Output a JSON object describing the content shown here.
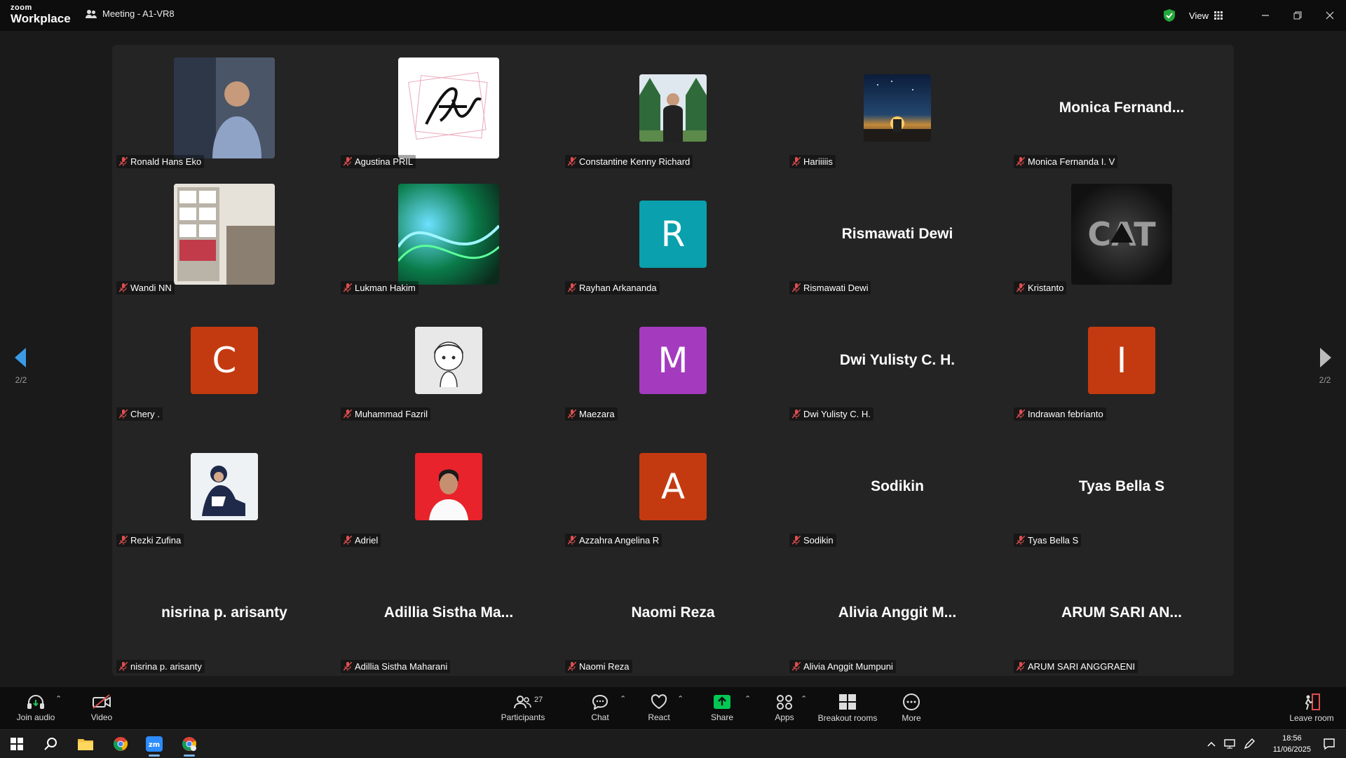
{
  "app": {
    "logo_small": "zoom",
    "logo_big": "Workplace",
    "meeting_title": "Meeting - A1-VR8"
  },
  "header": {
    "view_label": "View"
  },
  "pager": {
    "left": "2/2",
    "right": "2/2"
  },
  "tiles": [
    {
      "display": "",
      "tag": "Ronald Hans Eko"
    },
    {
      "display": "",
      "tag": "Agustina PRIL"
    },
    {
      "display": "",
      "tag": "Constantine Kenny Richard"
    },
    {
      "display": "",
      "tag": "Hariiiiis"
    },
    {
      "display": "Monica  Fernand...",
      "tag": "Monica Fernanda I. V"
    },
    {
      "display": "",
      "tag": "Wandi NN"
    },
    {
      "display": "",
      "tag": "Lukman Hakim"
    },
    {
      "display": "R",
      "tag": "Rayhan Arkananda"
    },
    {
      "display": "Rismawati Dewi",
      "tag": "Rismawati Dewi"
    },
    {
      "display": "",
      "tag": "Kristanto"
    },
    {
      "display": "C",
      "tag": "Chery ."
    },
    {
      "display": "",
      "tag": "Muhammad Fazril"
    },
    {
      "display": "M",
      "tag": "Maezara"
    },
    {
      "display": "Dwi Yulisty C. H.",
      "tag": "Dwi Yulisty C. H."
    },
    {
      "display": "I",
      "tag": "Indrawan febrianto"
    },
    {
      "display": "",
      "tag": "Rezki Zufina"
    },
    {
      "display": "",
      "tag": "Adriel"
    },
    {
      "display": "A",
      "tag": "Azzahra Angelina R"
    },
    {
      "display": "Sodikin",
      "tag": "Sodikin"
    },
    {
      "display": "Tyas Bella S",
      "tag": "Tyas Bella S"
    },
    {
      "display": "nisrina p. arisanty",
      "tag": "nisrina p. arisanty"
    },
    {
      "display": "Adillia  Sistha  Ma...",
      "tag": "Adillia Sistha Maharani"
    },
    {
      "display": "Naomi Reza",
      "tag": "Naomi Reza"
    },
    {
      "display": "Alivia  Anggit  M...",
      "tag": "Alivia Anggit Mumpuni"
    },
    {
      "display": "ARUM  SARI  AN...",
      "tag": "ARUM SARI ANGGRAENI"
    }
  ],
  "toolbar": {
    "join_audio": "Join audio",
    "video": "Video",
    "participants": "Participants",
    "participants_count": "27",
    "chat": "Chat",
    "react": "React",
    "share": "Share",
    "apps": "Apps",
    "breakout": "Breakout rooms",
    "more": "More",
    "leave": "Leave room"
  },
  "taskbar": {
    "time": "18:56",
    "date": "11/06/2025"
  },
  "colors": {
    "teal": "#0aa0ad",
    "orange": "#c43a10",
    "purple": "#a43bbf",
    "accent": "#0e72ed",
    "share_green": "#00c853"
  }
}
